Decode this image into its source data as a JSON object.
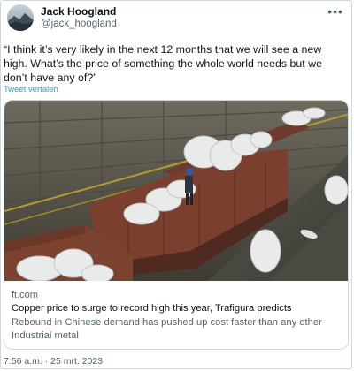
{
  "author": {
    "name": "Jack Hoogland",
    "handle": "@jack_hoogland"
  },
  "more_icon": "more-horizontal-icon",
  "tweet": {
    "text": "“I think it’s very likely in the next 12 months that we will see a new high. What’s the price of something the whole world needs but we don’t have any of?”",
    "translate_label": "Tweet vertalen",
    "timestamp": "7:56 a.m. · 25 mrt. 2023"
  },
  "card": {
    "domain": "ft.com",
    "title": "Copper price to surge to record high this year, Trafigura predicts",
    "description": "Rebound in Chinese demand has pushed up cost faster than any other Industrial metal"
  },
  "colors": {
    "link": "#1d9bf0",
    "secondary_text": "#536471",
    "border": "#cfd9de"
  }
}
